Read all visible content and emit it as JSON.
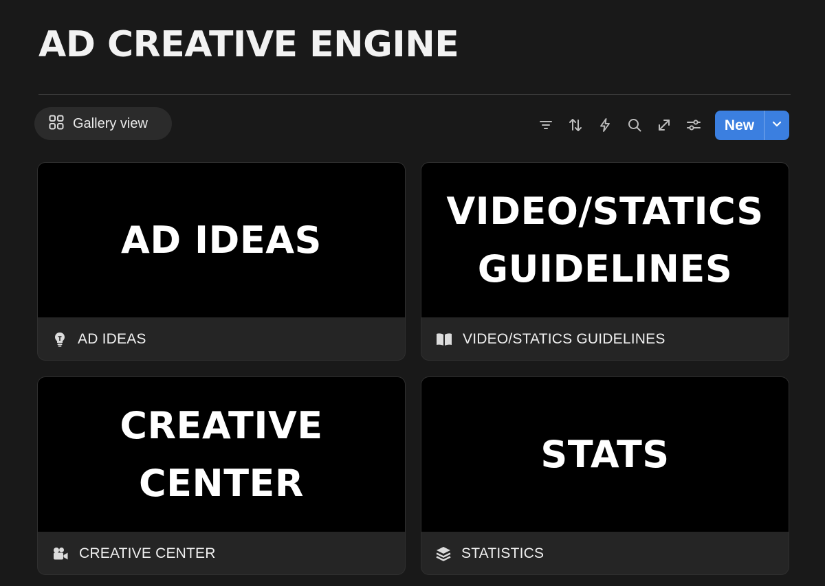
{
  "page": {
    "title": "AD CREATIVE ENGINE"
  },
  "toolbar": {
    "view_label": "Gallery view",
    "view_icon": "gallery-grid-icon",
    "tools": [
      {
        "name": "filter-icon"
      },
      {
        "name": "sort-icon"
      },
      {
        "name": "automation-lightning-icon"
      },
      {
        "name": "search-icon"
      },
      {
        "name": "expand-icon"
      },
      {
        "name": "settings-sliders-icon"
      }
    ],
    "new_label": "New",
    "accent_color": "#3b7fe0"
  },
  "gallery": {
    "cards": [
      {
        "cover_text": "AD IDEAS",
        "title": "AD IDEAS",
        "icon": "lightbulb-icon"
      },
      {
        "cover_text": "VIDEO/STATICS\nGUIDELINES",
        "title": "VIDEO/STATICS GUIDELINES",
        "icon": "open-book-icon"
      },
      {
        "cover_text": "CREATIVE\nCENTER",
        "title": "CREATIVE CENTER",
        "icon": "video-camera-icon"
      },
      {
        "cover_text": "STATS",
        "title": "STATISTICS",
        "icon": "layers-stack-icon"
      }
    ]
  }
}
